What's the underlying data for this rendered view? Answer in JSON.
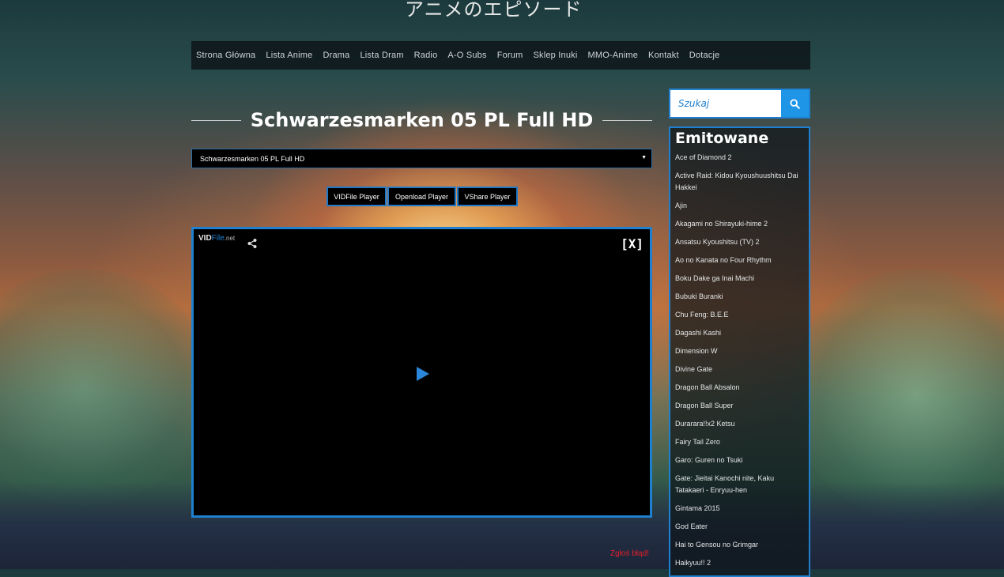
{
  "site_title": "アニメのエピソード",
  "nav": [
    "Strona Główna",
    "Lista Anime",
    "Drama",
    "Lista Dram",
    "Radio",
    "A-O Subs",
    "Forum",
    "Sklep Inuki",
    "MMO-Anime",
    "Kontakt",
    "Dotacje"
  ],
  "page_title": "Schwarzesmarken 05 PL Full HD",
  "episode_select": {
    "value": "Schwarzesmarken 05 PL Full HD"
  },
  "players": [
    "VIDFile Player",
    "Openload Player",
    "VShare Player"
  ],
  "video": {
    "logo_main": "VID",
    "logo_accent": "File",
    "logo_suffix": ".net",
    "close_label": "[X]"
  },
  "report_link": "Zgłoś błąd!",
  "search": {
    "placeholder": "Szukaj"
  },
  "sidebar": {
    "title": "Emitowane",
    "items": [
      "Ace of Diamond 2",
      "Active Raid: Kidou Kyoushuushitsu Dai Hakkei",
      "Ajin",
      "Akagami no Shirayuki-hime 2",
      "Ansatsu Kyoushitsu (TV) 2",
      "Ao no Kanata no Four Rhythm",
      "Boku Dake ga Inai Machi",
      "Bubuki Buranki",
      "Chu Feng: B.E.E",
      "Dagashi Kashi",
      "Dimension W",
      "Divine Gate",
      "Dragon Ball Absalon",
      "Dragon Ball Super",
      "Durarara!!x2 Ketsu",
      "Fairy Tail Zero",
      "Garo: Guren no Tsuki",
      "Gate: Jieitai Kanochi nite, Kaku Tatakaeri - Enryuu-hen",
      "Gintama 2015",
      "God Eater",
      "Hai to Gensou no Grimgar",
      "Haikyuu!! 2"
    ]
  },
  "colors": {
    "accent": "#1f80d0",
    "report": "#e0202a"
  }
}
